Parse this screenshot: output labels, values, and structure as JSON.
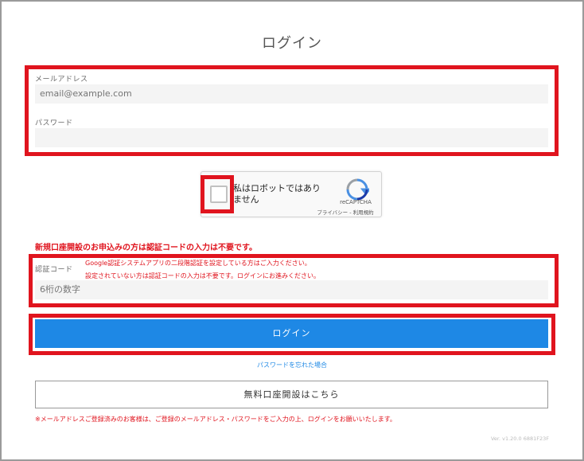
{
  "page": {
    "title": "ログイン"
  },
  "form": {
    "email_label": "メールアドレス",
    "email_placeholder": "email@example.com",
    "password_label": "パスワード",
    "password_value": ""
  },
  "recaptcha": {
    "checkbox_text": "私はロボットではありません",
    "brand": "reCAPTCHA",
    "links": "プライバシー - 利用規約",
    "logo_icon": "recaptcha-logo-icon"
  },
  "auth_code": {
    "notice": "新規口座開設のお申込みの方は認証コードの入力は不要です。",
    "label": "認証コード",
    "note_line1": "Google認証システムアプリの二段階認証を設定している方はご入力ください。",
    "note_line2": "設定されていない方は認証コードの入力は不要です。ログインにお進みください。",
    "placeholder": "6桁の数字"
  },
  "actions": {
    "login_label": "ログイン",
    "forgot_password": "パスワードを忘れた場合",
    "open_account": "無料口座開設はこちら"
  },
  "footer": {
    "note": "※メールアドレスご登録済みのお客様は、ご登録のメールアドレス・パスワードをご入力の上、ログインをお願いいたします。",
    "version": "Ver. v1.20.0 6881F23F"
  },
  "colors": {
    "highlight": "#e0141e",
    "primary": "#1e88e5"
  }
}
